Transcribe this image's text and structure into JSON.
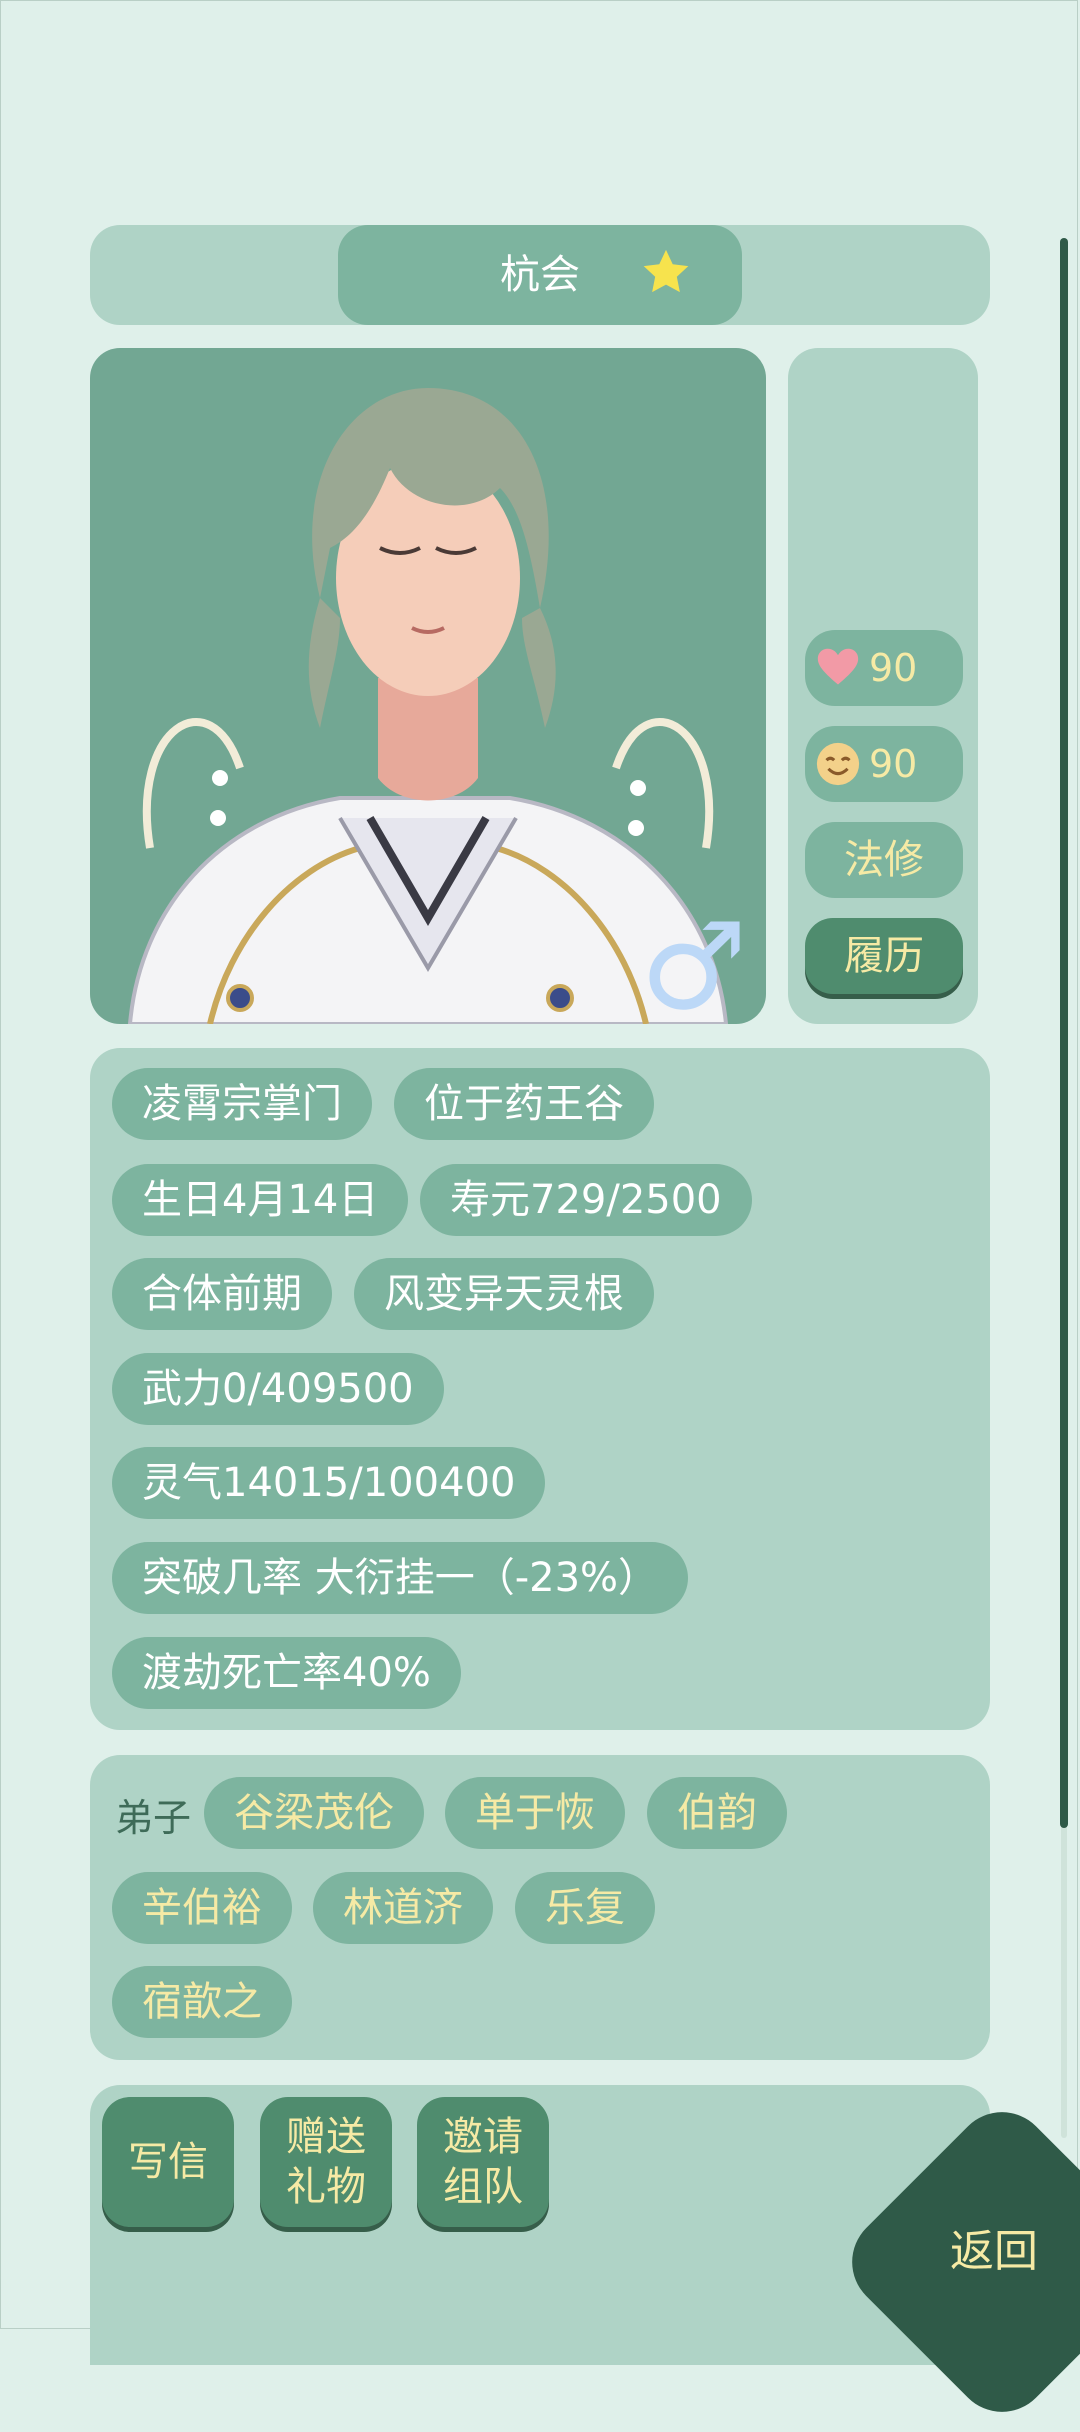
{
  "character": {
    "name": "杭会",
    "gender_symbol": "♂",
    "affection": "90",
    "mood": "90",
    "class_label": "法修",
    "resume_label": "履历"
  },
  "info_tags": [
    [
      "凌霄宗掌门",
      "位于药王谷"
    ],
    [
      "生日4月14日",
      "寿元729/2500"
    ],
    [
      "合体前期",
      "风变异天灵根"
    ],
    [
      "武力0/409500"
    ],
    [
      "灵气14015/100400"
    ],
    [
      "突破几率 大衍挂一（-23%）"
    ],
    [
      "渡劫死亡率40%"
    ]
  ],
  "disciples": {
    "label": "弟子",
    "names": [
      "谷梁茂伦",
      "单于恢",
      "伯韵",
      "辛伯裕",
      "林道济",
      "乐复",
      "宿歆之"
    ]
  },
  "actions": {
    "write_letter": "写信",
    "gift_line1": "赠送",
    "gift_line2": "礼物",
    "invite_line1": "邀请",
    "invite_line2": "组队",
    "return": "返回"
  },
  "colors": {
    "background": "#dff0ea",
    "panel": "#afd3c6",
    "pill": "#7db49f",
    "button": "#4f8c6e",
    "accent_text": "#f6eaa5",
    "dark": "#2f5a48"
  },
  "icons": [
    "star-icon",
    "heart-icon",
    "smile-icon",
    "male-symbol-icon"
  ]
}
